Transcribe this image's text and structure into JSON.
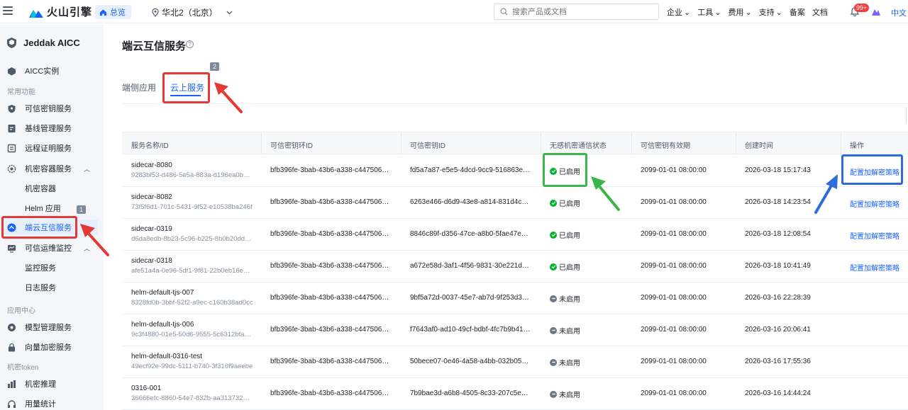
{
  "topbar": {
    "brand": "火山引擎",
    "home_label": "总览",
    "region": "华北2（北京）",
    "search_placeholder": "搜索产品或文档",
    "nav": [
      "企业",
      "工具",
      "费用",
      "支持",
      "备案",
      "文档"
    ],
    "notif_badge": "99+",
    "lang": "中文"
  },
  "sidebar": {
    "title": "Jeddak AICC",
    "items": [
      {
        "label": "AICC实例"
      },
      {
        "label": "常用功能"
      },
      {
        "label": "可信密钥服务"
      },
      {
        "label": "基线管理服务"
      },
      {
        "label": "远程证明服务"
      },
      {
        "label": "机密容器服务"
      },
      {
        "label": "机密容器"
      },
      {
        "label": "Helm 应用"
      },
      {
        "label": "端云互信服务"
      },
      {
        "label": "可信运维监控"
      },
      {
        "label": "监控服务"
      },
      {
        "label": "日志服务"
      },
      {
        "label": "应用中心"
      },
      {
        "label": "模型管理服务"
      },
      {
        "label": "向量加密服务"
      },
      {
        "label": "机密token"
      },
      {
        "label": "机密推理"
      },
      {
        "label": "用量统计"
      }
    ]
  },
  "main": {
    "title": "端云互信服务",
    "tabs": [
      "端侧应用",
      "云上服务"
    ],
    "annotation_1": "1",
    "annotation_2": "2",
    "columns": [
      "服务名称/ID",
      "可信密钥环ID",
      "可信密钥ID",
      "无感机密通信状态",
      "可信密钥有效期",
      "创建时间",
      "操作"
    ],
    "rows": [
      {
        "name": "sidecar-8080",
        "id": "9283bf53-d486-5e5a-883a-d196ea0bce…",
        "ring": "bfb396fe-3bab-43b6-a338-c44750645b…",
        "key": "fd5a7a87-e5e5-4dcd-9cc9-516863e28cf8",
        "status": "已启用",
        "on": true,
        "expiry": "2099-01-01 08:00:00",
        "created": "2026-03-18 15:17:43",
        "action": "配置加解密策略"
      },
      {
        "name": "sidecar-8082",
        "id": "73f5f6d1-701c-5431-9f52-e10538ba246f",
        "ring": "bfb396fe-3bab-43b6-a338-c44750645b…",
        "key": "6263e466-d6d9-43e8-a814-831d4c010…",
        "status": "已启用",
        "on": true,
        "expiry": "2099-01-01 08:00:00",
        "created": "2026-03-18 14:23:54",
        "action": "配置加解密策略"
      },
      {
        "name": "sidecar-0319",
        "id": "d6da8edb-8b23-5c96-b225-8b0b20dd9…",
        "ring": "bfb396fe-3bab-43b6-a338-c44750645b…",
        "key": "8846c89f-d356-47ce-a8b0-5fae47e982f2",
        "status": "已启用",
        "on": true,
        "expiry": "2099-01-01 08:00:00",
        "created": "2026-03-18 12:08:54",
        "action": "配置加解密策略"
      },
      {
        "name": "sidecar-0318",
        "id": "afe51a4a-0e96-5df1-9f81-22b0eb16e916",
        "ring": "bfb396fe-3bab-43b6-a338-c44750645b…",
        "key": "a672e58d-3af1-4f56-9831-30e221ddcd…",
        "status": "已启用",
        "on": true,
        "expiry": "2099-01-01 08:00:00",
        "created": "2026-03-18 10:41:49",
        "action": "配置加解密策略"
      },
      {
        "name": "helm-default-tjs-007",
        "id": "8328fd0b-3bbf-52f2-a9ec-c160b38ad0cc",
        "ring": "bfb396fe-3bab-43b6-a338-c44750645b…",
        "key": "9bf5a72d-0037-45e7-ab7d-9f253d3dc2…",
        "status": "未启用",
        "on": false,
        "expiry": "2099-01-01 08:00:00",
        "created": "2026-03-16 22:28:39",
        "action": ""
      },
      {
        "name": "helm-default-tjs-006",
        "id": "9c3f4880-01e5-50d6-9555-5c6312bfa9…",
        "ring": "bfb396fe-3bab-43b6-a338-c44750645b…",
        "key": "f7643af0-ad10-49cf-bdbf-4fc7b9b41cc1",
        "status": "未启用",
        "on": false,
        "expiry": "2099-01-01 08:00:00",
        "created": "2026-03-16 20:06:41",
        "action": ""
      },
      {
        "name": "helm-default-0316-test",
        "id": "49ecf92e-99dc-5111-b740-3f316f9aeebe",
        "ring": "bfb396fe-3bab-43b6-a338-c44750645b…",
        "key": "50bece07-0e46-4a58-a4bb-032b0595ed…",
        "status": "未启用",
        "on": false,
        "expiry": "2099-01-01 08:00:00",
        "created": "2026-03-16 17:55:36",
        "action": ""
      },
      {
        "name": "0316-001",
        "id": "36666efc-8860-54e7-832b-aa31373274…",
        "ring": "bfb396fe-3bab-43b6-a338-c44750645b…",
        "key": "7b9bae3d-a6b8-4505-8c33-207c5e9010…",
        "status": "未启用",
        "on": false,
        "expiry": "2099-01-01 08:00:00",
        "created": "2026-03-16 14:44:24",
        "action": ""
      }
    ]
  },
  "colors": {
    "accent": "#1664ff",
    "annot_red": "#e53935",
    "annot_green": "#3cb54a",
    "annot_blue": "#2f6bdc",
    "status_on": "#00b42a"
  }
}
